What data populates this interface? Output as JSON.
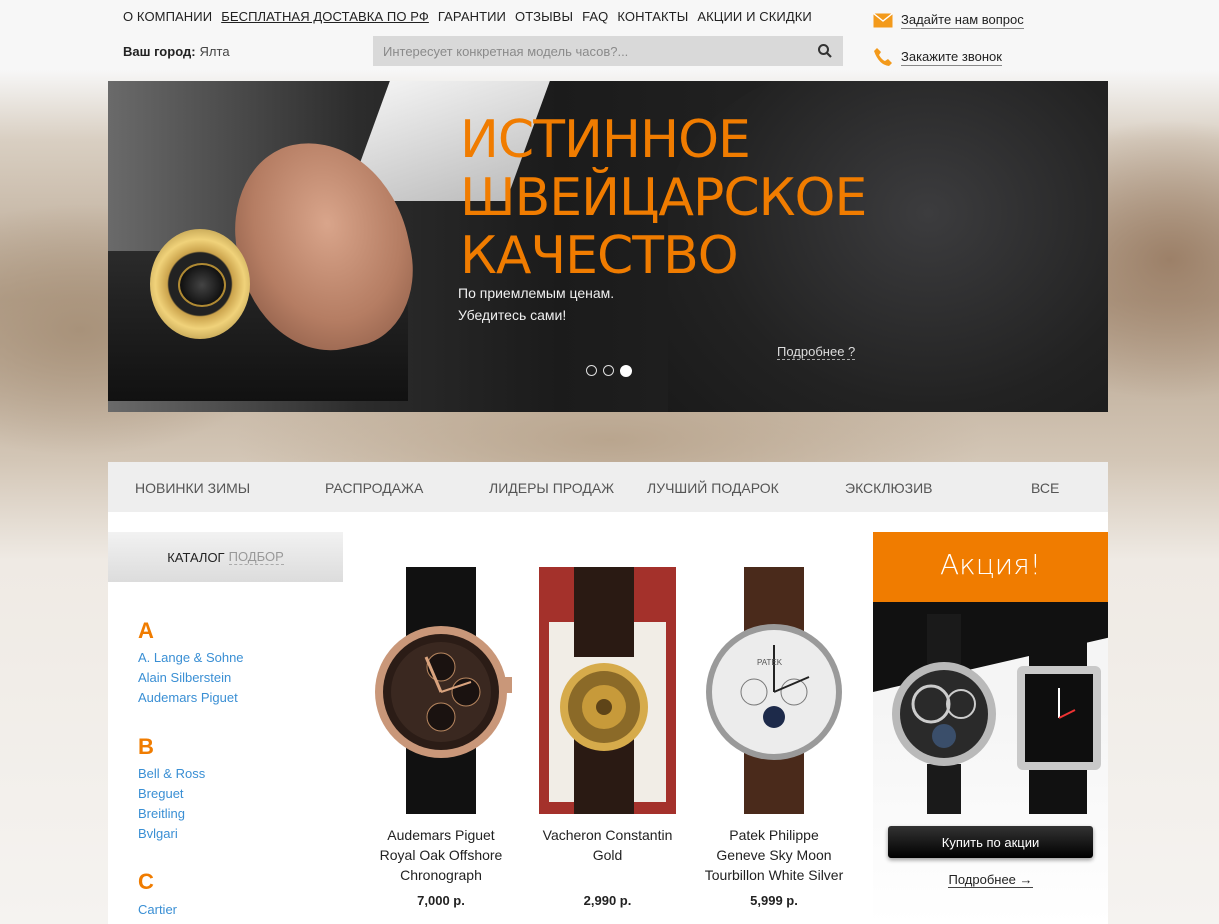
{
  "top_nav": {
    "items": [
      "О КОМПАНИИ",
      "БЕСПЛАТНАЯ ДОСТАВКА ПО РФ",
      "ГАРАНТИИ",
      "ОТЗЫВЫ",
      "FAQ",
      "КОНТАКТЫ",
      "АКЦИИ И СКИДКИ"
    ]
  },
  "city": {
    "label": "Ваш город:",
    "value": "Ялта"
  },
  "search": {
    "placeholder": "Интересует конкретная модель часов?..."
  },
  "contacts": {
    "ask": "Задайте нам вопрос",
    "call": "Закажите звонок"
  },
  "hero": {
    "line1": "ИСТИННОЕ",
    "line2": "ШВЕЙЦАРСКОЕ",
    "line3": "КАЧЕСТВО",
    "sub1": "По приемлемым ценам.",
    "sub2": "Убедитесь сами!",
    "more": "Подробнее ?",
    "slides": 3,
    "active_slide": 3
  },
  "categories": [
    "НОВИНКИ ЗИМЫ",
    "РАСПРОДАЖА",
    "ЛИДЕРЫ ПРОДАЖ",
    "ЛУЧШИЙ ПОДАРОК",
    "ЭКСКЛЮЗИВ",
    "ВСЕ"
  ],
  "catalog": {
    "label": "КАТАЛОГ",
    "filter": "ПОДБОР",
    "groups": [
      {
        "letter": "A",
        "brands": [
          "A. Lange & Sohne",
          "Alain Silberstein",
          "Audemars Piguet"
        ]
      },
      {
        "letter": "B",
        "brands": [
          "Bell & Ross",
          "Breguet",
          "Breitling",
          "Bvlgari"
        ]
      },
      {
        "letter": "C",
        "brands": [
          "Cartier"
        ]
      }
    ]
  },
  "products": [
    {
      "name1": "Audemars Piguet",
      "name2": "Royal Oak Offshore",
      "name3": "Chronograph",
      "price": "7,000 р."
    },
    {
      "name1": "Vacheron Constantin",
      "name2": "Gold",
      "name3": "",
      "price": "2,990 р."
    },
    {
      "name1": "Patek Philippe",
      "name2": "Geneve Sky Moon",
      "name3": "Tourbillon White Silver",
      "price": "5,999 р."
    }
  ],
  "promo": {
    "title": "Акция!",
    "buy": "Купить по акции",
    "more": "Подробнее →"
  },
  "colors": {
    "accent": "#f07c00",
    "link": "#3a8fd4"
  }
}
